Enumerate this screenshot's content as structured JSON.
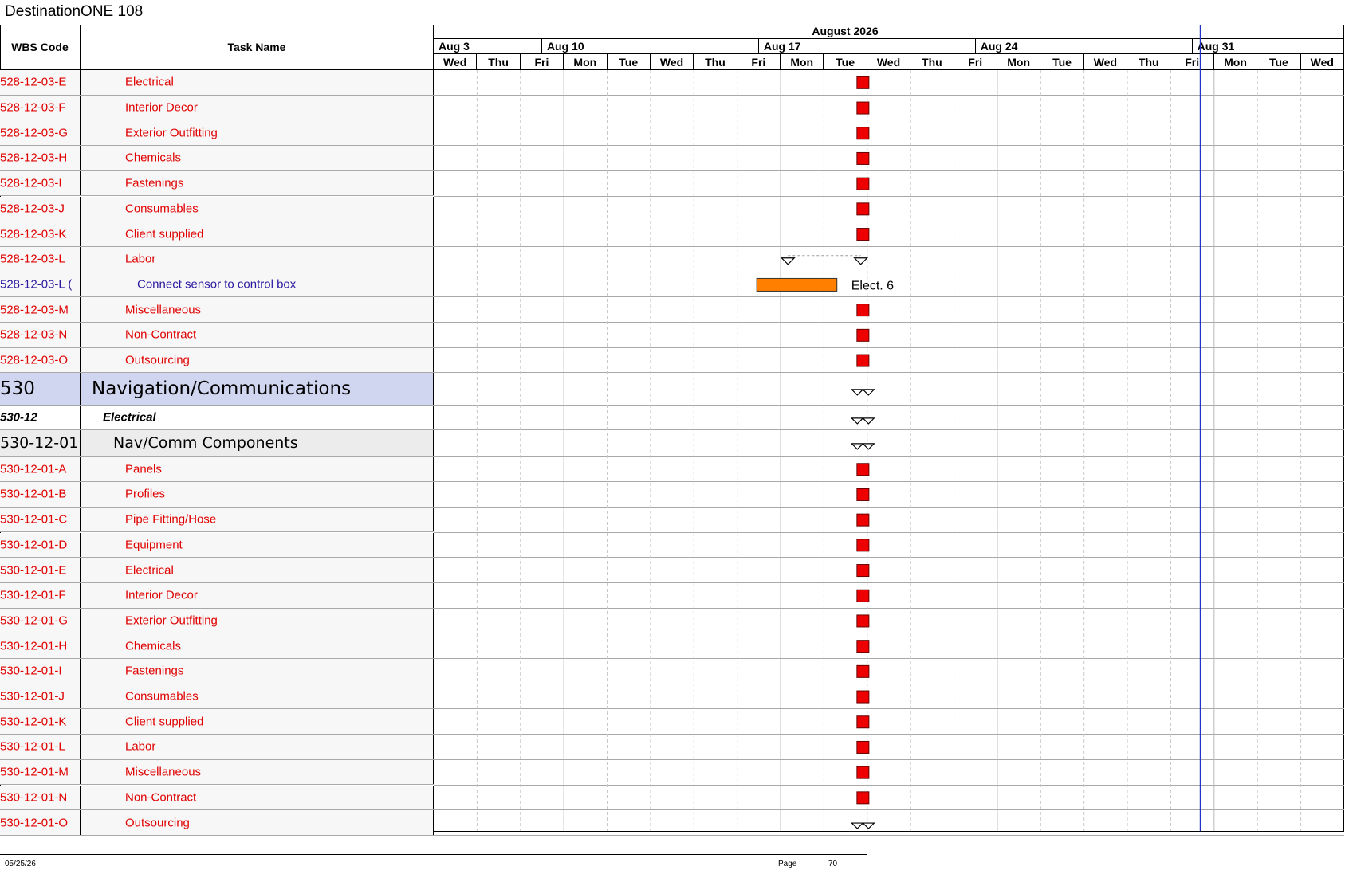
{
  "title": "DestinationONE 108",
  "columns": {
    "wbs": "WBS Code",
    "task": "Task Name"
  },
  "timeline": {
    "month": "August 2026",
    "weeks": [
      "Aug 3",
      "Aug 10",
      "Aug 17",
      "Aug 24",
      "Aug 31"
    ],
    "days": [
      "Wed",
      "Thu",
      "Fri",
      "Mon",
      "Tue",
      "Wed",
      "Thu",
      "Fri",
      "Mon",
      "Tue",
      "Wed",
      "Thu",
      "Fri",
      "Mon",
      "Tue",
      "Wed",
      "Thu",
      "Fri",
      "Mon",
      "Tue",
      "Wed"
    ]
  },
  "rows": [
    {
      "wbs": "528-12-03-E",
      "name": "Electrical",
      "level": "task",
      "mark": "milestone"
    },
    {
      "wbs": "528-12-03-F",
      "name": "Interior Decor",
      "level": "task",
      "mark": "milestone"
    },
    {
      "wbs": "528-12-03-G",
      "name": "Exterior Outfitting",
      "level": "task",
      "mark": "milestone"
    },
    {
      "wbs": "528-12-03-H",
      "name": "Chemicals",
      "level": "task",
      "mark": "milestone"
    },
    {
      "wbs": "528-12-03-I",
      "name": "Fastenings",
      "level": "task",
      "mark": "milestone"
    },
    {
      "wbs": "528-12-03-J",
      "name": "Consumables",
      "level": "task",
      "mark": "milestone"
    },
    {
      "wbs": "528-12-03-K",
      "name": "Client supplied",
      "level": "task",
      "mark": "milestone"
    },
    {
      "wbs": "528-12-03-L",
      "name": "Labor",
      "level": "task",
      "mark": "summary-open"
    },
    {
      "wbs": "528-12-03-L (",
      "name": "Connect sensor to control box",
      "level": "sub",
      "mark": "bar"
    },
    {
      "wbs": "528-12-03-M",
      "name": "Miscellaneous",
      "level": "task",
      "mark": "milestone"
    },
    {
      "wbs": "528-12-03-N",
      "name": "Non-Contract",
      "level": "task",
      "mark": "milestone"
    },
    {
      "wbs": "528-12-03-O",
      "name": "Outsourcing",
      "level": "task",
      "mark": "milestone"
    },
    {
      "wbs": "530",
      "name": "Navigation/Communications",
      "level": "top",
      "mark": "summary"
    },
    {
      "wbs": "530-12",
      "name": "Electrical",
      "level": "mid",
      "mark": "summary"
    },
    {
      "wbs": "530-12-01",
      "name": "Nav/Comm Components",
      "level": "grp",
      "mark": "summary"
    },
    {
      "wbs": "530-12-01-A",
      "name": "Panels",
      "level": "task",
      "mark": "milestone"
    },
    {
      "wbs": "530-12-01-B",
      "name": "Profiles",
      "level": "task",
      "mark": "milestone"
    },
    {
      "wbs": "530-12-01-C",
      "name": "Pipe Fitting/Hose",
      "level": "task",
      "mark": "milestone"
    },
    {
      "wbs": "530-12-01-D",
      "name": "Equipment",
      "level": "task",
      "mark": "milestone"
    },
    {
      "wbs": "530-12-01-E",
      "name": "Electrical",
      "level": "task",
      "mark": "milestone"
    },
    {
      "wbs": "530-12-01-F",
      "name": "Interior Decor",
      "level": "task",
      "mark": "milestone"
    },
    {
      "wbs": "530-12-01-G",
      "name": "Exterior Outfitting",
      "level": "task",
      "mark": "milestone"
    },
    {
      "wbs": "530-12-01-H",
      "name": "Chemicals",
      "level": "task",
      "mark": "milestone"
    },
    {
      "wbs": "530-12-01-I",
      "name": "Fastenings",
      "level": "task",
      "mark": "milestone"
    },
    {
      "wbs": "530-12-01-J",
      "name": "Consumables",
      "level": "task",
      "mark": "milestone"
    },
    {
      "wbs": "530-12-01-K",
      "name": "Client supplied",
      "level": "task",
      "mark": "milestone"
    },
    {
      "wbs": "530-12-01-L",
      "name": "Labor",
      "level": "task",
      "mark": "milestone"
    },
    {
      "wbs": "530-12-01-M",
      "name": "Miscellaneous",
      "level": "task",
      "mark": "milestone"
    },
    {
      "wbs": "530-12-01-N",
      "name": "Non-Contract",
      "level": "task",
      "mark": "milestone"
    },
    {
      "wbs": "530-12-01-O",
      "name": "Outsourcing",
      "level": "task",
      "mark": "summary"
    }
  ],
  "bar_label": "Elect. 6",
  "colors": {
    "milestone": "#ee0000",
    "bar": "#ff8000",
    "today_line": "#2233cc"
  },
  "footer": {
    "date": "05/25/26",
    "page_label": "Page",
    "page_number": "70"
  }
}
